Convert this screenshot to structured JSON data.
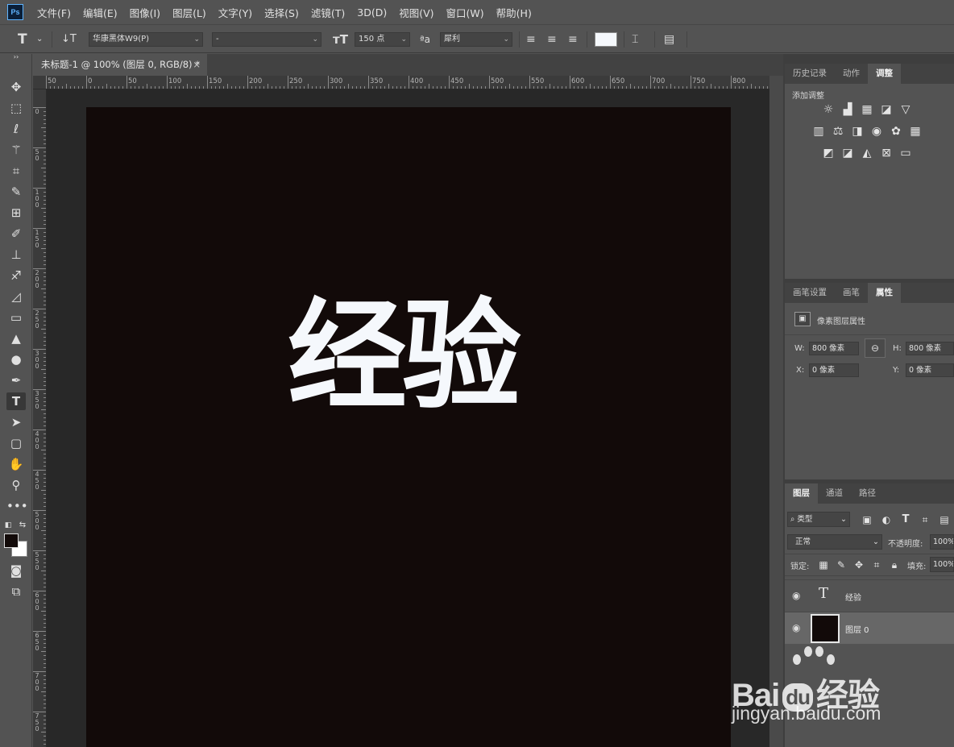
{
  "app": {
    "logo_text": "Ps"
  },
  "menu": [
    "文件(F)",
    "编辑(E)",
    "图像(I)",
    "图层(L)",
    "文字(Y)",
    "选择(S)",
    "滤镜(T)",
    "3D(D)",
    "视图(V)",
    "窗口(W)",
    "帮助(H)"
  ],
  "options_bar": {
    "font_family": "华康黑体W9(P)",
    "font_style": "-",
    "font_size": "150 点",
    "antialias": "犀利",
    "text_color": "#f5f8fc"
  },
  "document": {
    "tab_title": "未标题-1 @ 100% (图层 0, RGB/8) *",
    "tab_close": "×",
    "canvas_text": "经验",
    "canvas_color": "#120a09",
    "ruler_top": [
      "50",
      "0",
      "50",
      "100",
      "150",
      "200",
      "250",
      "300",
      "350",
      "400",
      "450",
      "500",
      "550",
      "600",
      "650",
      "700",
      "750",
      "800"
    ],
    "ruler_left": [
      "0",
      "50",
      "100",
      "150",
      "200",
      "250",
      "300",
      "350",
      "400",
      "450",
      "500",
      "550",
      "600",
      "650",
      "700",
      "750"
    ]
  },
  "panels": {
    "top_tabs": [
      "历史记录",
      "动作",
      "调整"
    ],
    "adjust_label": "添加调整",
    "mid_tabs": [
      "画笔设置",
      "画笔",
      "属性"
    ],
    "properties": {
      "title": "像素图层属性",
      "w_label": "W:",
      "w_value": "800 像素",
      "h_label": "H:",
      "h_value": "800 像素",
      "x_label": "X:",
      "x_value": "0 像素",
      "y_label": "Y:",
      "y_value": "0 像素"
    },
    "layer_tabs": [
      "图层",
      "通道",
      "路径"
    ],
    "layers": {
      "filter_kind": "类型",
      "blend_mode": "正常",
      "opacity_label": "不透明度:",
      "opacity_value": "100%",
      "lock_label": "锁定:",
      "fill_label": "填充:",
      "fill_value": "100%",
      "items": [
        {
          "name": "经验",
          "type": "text"
        },
        {
          "name": "图层 0",
          "type": "pixel"
        }
      ]
    }
  },
  "watermark": {
    "brand_a": "Bai",
    "brand_b": "du",
    "brand_c": "经验",
    "url": "jingyan.baidu.com"
  }
}
